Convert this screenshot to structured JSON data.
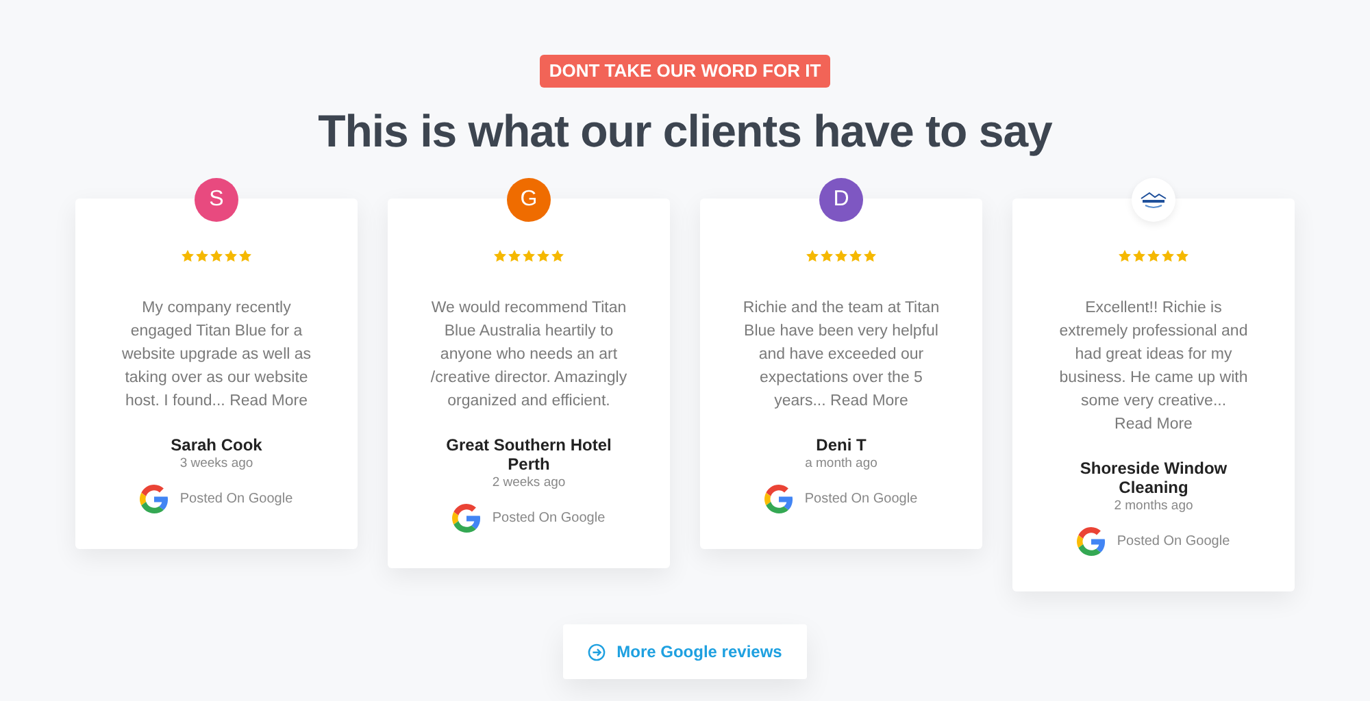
{
  "eyebrow": "DONT TAKE OUR WORD FOR IT",
  "heading": "This is what our clients have to say",
  "reviews": [
    {
      "avatar": {
        "kind": "letter",
        "letter": "S",
        "color": "#e84a7f"
      },
      "stars": 5,
      "text": "My company recently engaged Titan Blue for a website upgrade as well as taking over as our website host. I found...",
      "read_more": "Read More",
      "name": "Sarah Cook",
      "time": "3 weeks ago",
      "source": "Posted On Google"
    },
    {
      "avatar": {
        "kind": "letter",
        "letter": "G",
        "color": "#ef6c00"
      },
      "stars": 5,
      "text": "We would recommend Titan Blue Australia heartily to anyone who needs an art /creative director. Amazingly organized and efficient.",
      "name": "Great Southern Hotel Perth",
      "time": "2 weeks ago",
      "source": "Posted On Google"
    },
    {
      "avatar": {
        "kind": "letter",
        "letter": "D",
        "color": "#7e57c2"
      },
      "stars": 5,
      "text": "Richie and the team at Titan Blue have been very helpful and have exceeded our expectations over the 5 years...",
      "read_more": "Read More",
      "name": "Deni T",
      "time": "a month ago",
      "source": "Posted On Google"
    },
    {
      "avatar": {
        "kind": "logo"
      },
      "stars": 5,
      "text": "Excellent!! Richie is extremely professional and had great ideas for my business. He came up with some very creative...",
      "read_more": "Read More",
      "name": "Shoreside Window Cleaning",
      "time": "2 months ago",
      "source": "Posted On Google"
    }
  ],
  "more_button": "More Google reviews"
}
